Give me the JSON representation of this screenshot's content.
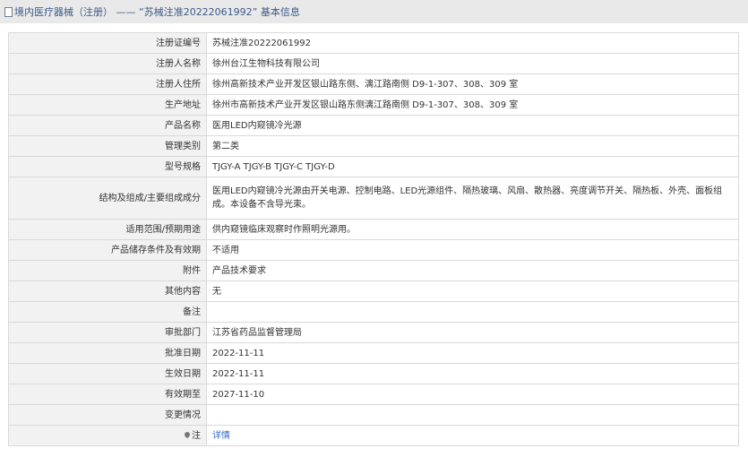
{
  "header": {
    "title": "境内医疗器械（注册） —— “苏械注准20222061992” 基本信息"
  },
  "rows": [
    {
      "label": "注册证编号",
      "value": "苏械注准20222061992"
    },
    {
      "label": "注册人名称",
      "value": "徐州台江生物科技有限公司"
    },
    {
      "label": "注册人住所",
      "value": "徐州高新技术产业开发区银山路东侧、漓江路南侧 D9-1-307、308、309 室"
    },
    {
      "label": "生产地址",
      "value": "徐州市高新技术产业开发区银山路东侧漓江路南侧 D9-1-307、308、309 室"
    },
    {
      "label": "产品名称",
      "value": "医用LED内窥镜冷光源"
    },
    {
      "label": "管理类别",
      "value": "第二类"
    },
    {
      "label": "型号规格",
      "value": "TJGY-A TJGY-B TJGY-C TJGY-D"
    },
    {
      "label": "结构及组成/主要组成成分",
      "value": "医用LED内窥镜冷光源由开关电源、控制电路、LED光源组件、隔热玻璃、风扇、散热器、亮度调节开关、隔热板、外壳、面板组成。本设备不含导光束。"
    },
    {
      "label": "适用范围/预期用途",
      "value": "供内窥镜临床观察时作照明光源用。"
    },
    {
      "label": "产品储存条件及有效期",
      "value": "不适用"
    },
    {
      "label": "附件",
      "value": "产品技术要求"
    },
    {
      "label": "其他内容",
      "value": "无"
    },
    {
      "label": "备注",
      "value": ""
    },
    {
      "label": "审批部门",
      "value": "江苏省药品监督管理局"
    },
    {
      "label": "批准日期",
      "value": "2022-11-11"
    },
    {
      "label": "生效日期",
      "value": "2022-11-11"
    },
    {
      "label": "有效期至",
      "value": "2027-11-10"
    },
    {
      "label": "变更情况",
      "value": ""
    },
    {
      "label": "注",
      "value": "详情"
    }
  ]
}
